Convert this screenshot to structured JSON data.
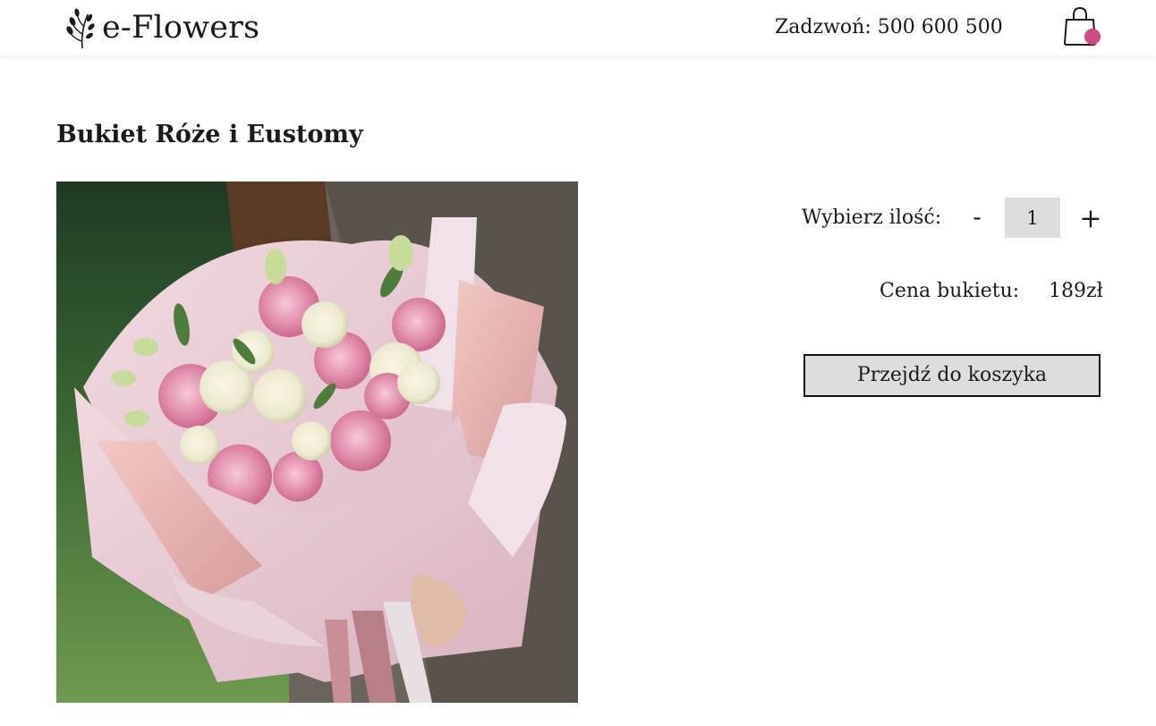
{
  "header": {
    "logo_text": "e-Flowers",
    "logo_icon": "leaf-branch-icon",
    "phone": "Zadzwoń: 500 600 500",
    "cart_icon": "shopping-bag-icon",
    "cart_badge_color": "#d14a86"
  },
  "product": {
    "title": "Bukiet Róże i Eustomy",
    "image_description_icon": "bouquet-photo",
    "quantity_label": "Wybierz ilość:",
    "minus_label": "-",
    "quantity_value": "1",
    "plus_label": "+",
    "price_label": "Cena bukietu:",
    "price_value": "189zł",
    "checkout_label": "Przejdź do koszyka"
  },
  "colors": {
    "accent": "#d14a86",
    "button_bg": "#dddddd",
    "text": "#1a1a1a"
  }
}
